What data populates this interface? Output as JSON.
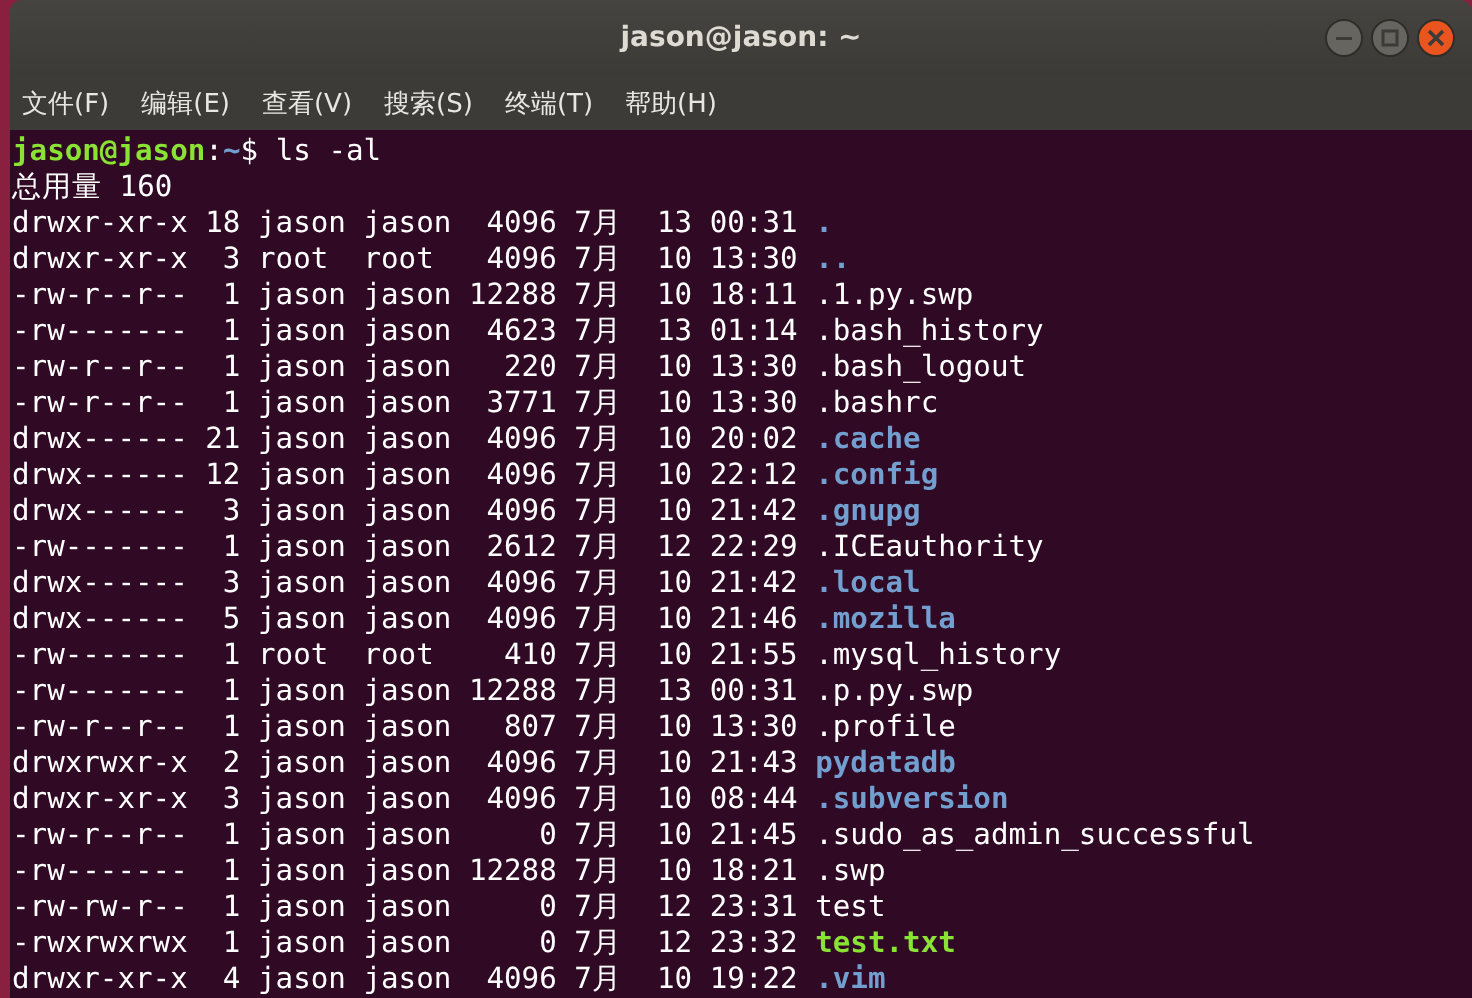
{
  "window": {
    "title": "jason@jason: ~"
  },
  "menu": [
    "文件(F)",
    "编辑(E)",
    "查看(V)",
    "搜索(S)",
    "终端(T)",
    "帮助(H)"
  ],
  "terminal": {
    "prompt": {
      "user_host": "jason@jason",
      "separator": ":",
      "path": "~",
      "symbol": "$",
      "command": "ls -al"
    },
    "total": "总用量 160",
    "entries": [
      {
        "listing": "drwxr-xr-x 18 jason jason  4096 7月  13 00:31",
        "name": ".",
        "kind": "directory"
      },
      {
        "listing": "drwxr-xr-x  3 root  root   4096 7月  10 13:30",
        "name": "..",
        "kind": "directory"
      },
      {
        "listing": "-rw-r--r--  1 jason jason 12288 7月  10 18:11",
        "name": ".1.py.swp",
        "kind": "file"
      },
      {
        "listing": "-rw-------  1 jason jason  4623 7月  13 01:14",
        "name": ".bash_history",
        "kind": "file"
      },
      {
        "listing": "-rw-r--r--  1 jason jason   220 7月  10 13:30",
        "name": ".bash_logout",
        "kind": "file"
      },
      {
        "listing": "-rw-r--r--  1 jason jason  3771 7月  10 13:30",
        "name": ".bashrc",
        "kind": "file"
      },
      {
        "listing": "drwx------ 21 jason jason  4096 7月  10 20:02",
        "name": ".cache",
        "kind": "directory"
      },
      {
        "listing": "drwx------ 12 jason jason  4096 7月  10 22:12",
        "name": ".config",
        "kind": "directory"
      },
      {
        "listing": "drwx------  3 jason jason  4096 7月  10 21:42",
        "name": ".gnupg",
        "kind": "directory"
      },
      {
        "listing": "-rw-------  1 jason jason  2612 7月  12 22:29",
        "name": ".ICEauthority",
        "kind": "file"
      },
      {
        "listing": "drwx------  3 jason jason  4096 7月  10 21:42",
        "name": ".local",
        "kind": "directory"
      },
      {
        "listing": "drwx------  5 jason jason  4096 7月  10 21:46",
        "name": ".mozilla",
        "kind": "directory"
      },
      {
        "listing": "-rw-------  1 root  root    410 7月  10 21:55",
        "name": ".mysql_history",
        "kind": "file"
      },
      {
        "listing": "-rw-------  1 jason jason 12288 7月  13 00:31",
        "name": ".p.py.swp",
        "kind": "file"
      },
      {
        "listing": "-rw-r--r--  1 jason jason   807 7月  10 13:30",
        "name": ".profile",
        "kind": "file"
      },
      {
        "listing": "drwxrwxr-x  2 jason jason  4096 7月  10 21:43",
        "name": "pydatadb",
        "kind": "directory"
      },
      {
        "listing": "drwxr-xr-x  3 jason jason  4096 7月  10 08:44",
        "name": ".subversion",
        "kind": "directory"
      },
      {
        "listing": "-rw-r--r--  1 jason jason     0 7月  10 21:45",
        "name": ".sudo_as_admin_successful",
        "kind": "file"
      },
      {
        "listing": "-rw-------  1 jason jason 12288 7月  10 18:21",
        "name": ".swp",
        "kind": "file"
      },
      {
        "listing": "-rw-rw-r--  1 jason jason     0 7月  12 23:31",
        "name": "test",
        "kind": "file"
      },
      {
        "listing": "-rwxrwxrwx  1 jason jason     0 7月  12 23:32",
        "name": "test.txt",
        "kind": "executable"
      },
      {
        "listing": "drwxr-xr-x  4 jason jason  4096 7月  10 19:22",
        "name": ".vim",
        "kind": "directory"
      }
    ]
  }
}
